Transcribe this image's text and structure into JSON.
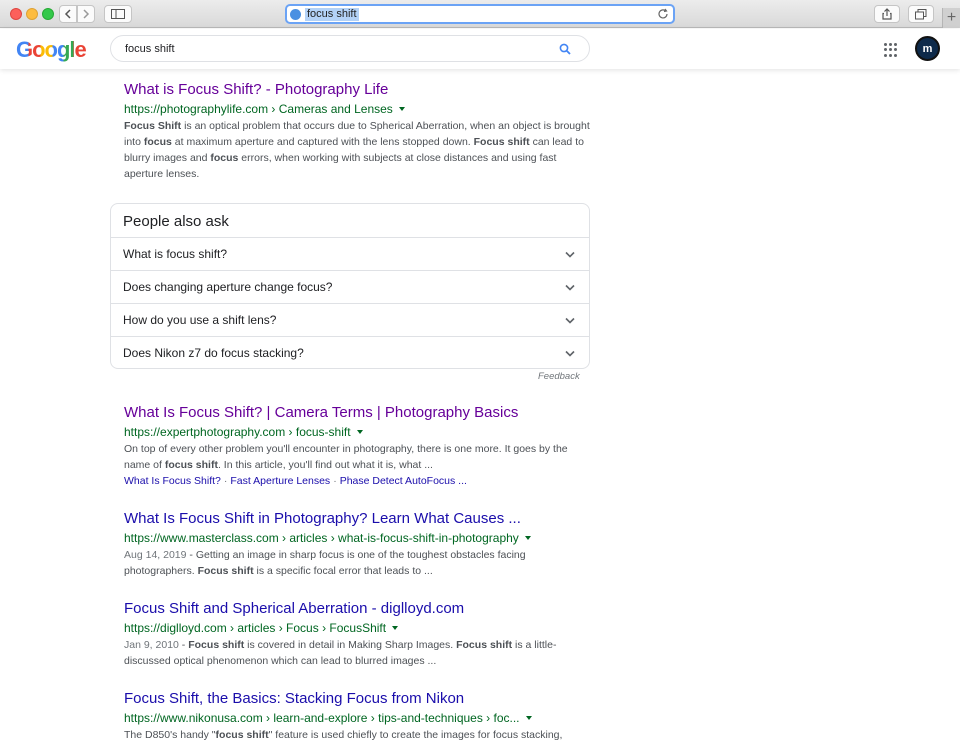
{
  "browser": {
    "url": "focus shift"
  },
  "google": {
    "logo": "Google",
    "query": "focus shift",
    "avatar_initials": "m"
  },
  "colors": {
    "link": "#1a0dab",
    "visited": "#660099",
    "url_green": "#006621",
    "snippet": "#4d5156"
  },
  "results": [
    {
      "title": "What is Focus Shift? - Photography Life",
      "url": "https://photographylife.com › Cameras and Lenses",
      "visited": true,
      "snippet": [
        [
          "b",
          "Focus Shift"
        ],
        [
          "t",
          " is an optical problem that occurs due to Spherical Aberration, when an object is brought into "
        ],
        [
          "b",
          "focus"
        ],
        [
          "t",
          " at maximum aperture and captured with the lens stopped down. "
        ],
        [
          "b",
          "Focus shift"
        ],
        [
          "t",
          " can lead to blurry images and "
        ],
        [
          "b",
          "focus"
        ],
        [
          "t",
          " errors, when working with subjects at close distances and using fast aperture lenses."
        ]
      ]
    },
    {
      "title": "What Is Focus Shift? | Camera Terms | Photography Basics",
      "url": "https://expertphotography.com › focus-shift",
      "visited": true,
      "snippet": [
        [
          "t",
          "On top of every other problem you'll encounter in photography, there is one more. It goes by the name of "
        ],
        [
          "b",
          "focus shift"
        ],
        [
          "t",
          ". In this article, you'll find out what it is, what ..."
        ]
      ],
      "sitelinks": [
        "What Is Focus Shift?",
        "Fast Aperture Lenses",
        "Phase Detect AutoFocus ..."
      ]
    },
    {
      "title": "What Is Focus Shift in Photography? Learn What Causes ...",
      "url": "https://www.masterclass.com › articles › what-is-focus-shift-in-photography",
      "visited": false,
      "date": "Aug 14, 2019",
      "snippet": [
        [
          "t",
          "Getting an image in sharp focus is one of the toughest obstacles facing photographers. "
        ],
        [
          "b",
          "Focus shift"
        ],
        [
          "t",
          " is a specific focal error that leads to ..."
        ]
      ]
    },
    {
      "title": "Focus Shift and Spherical Aberration - diglloyd.com",
      "url": "https://diglloyd.com › articles › Focus › FocusShift",
      "visited": false,
      "date": "Jan 9, 2010",
      "snippet": [
        [
          "b",
          "Focus shift"
        ],
        [
          "t",
          " is covered in detail in Making Sharp Images. "
        ],
        [
          "b",
          "Focus shift"
        ],
        [
          "t",
          " is a little-discussed optical phenomenon which can lead to blurred images ..."
        ]
      ]
    },
    {
      "title": "Focus Shift, the Basics: Stacking Focus from Nikon",
      "url": "https://www.nikonusa.com › learn-and-explore › tips-and-techniques › foc...",
      "visited": false,
      "snippet": [
        [
          "t",
          "The D850's handy \""
        ],
        [
          "b",
          "focus shift"
        ],
        [
          "t",
          "\" feature is used chiefly to create the images for focus stacking,"
        ]
      ]
    }
  ],
  "paa": {
    "heading": "People also ask",
    "questions": [
      "What is focus shift?",
      "Does changing aperture change focus?",
      "How do you use a shift lens?",
      "Does Nikon z7 do focus stacking?"
    ],
    "feedback": "Feedback"
  }
}
